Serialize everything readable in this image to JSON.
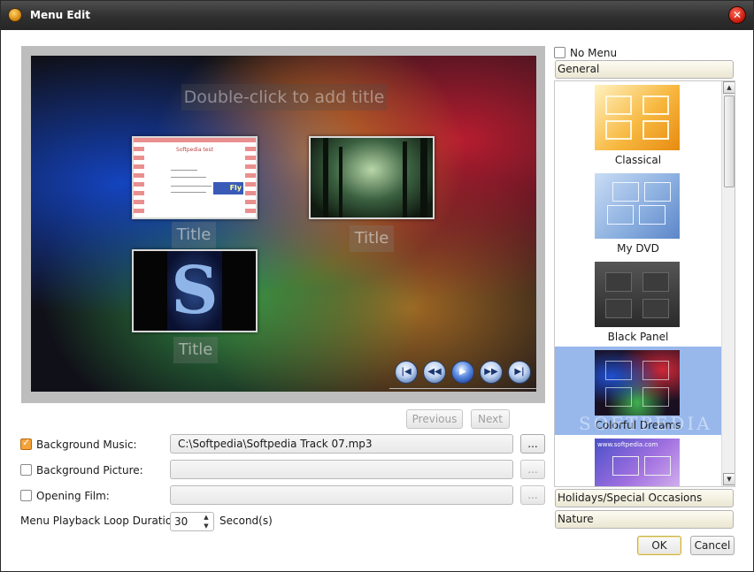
{
  "window": {
    "title": "Menu Edit"
  },
  "preview": {
    "title_placeholder": "Double-click to add title",
    "thumbnails": [
      {
        "label": "Title",
        "header": "Softpedia test",
        "logo": "Fly"
      },
      {
        "label": "Title"
      },
      {
        "label": "Title",
        "glyph": "S"
      }
    ]
  },
  "pager": {
    "previous": "Previous",
    "next": "Next"
  },
  "settings": {
    "background_music": {
      "label": "Background Music:",
      "checked": true,
      "value": "C:\\Softpedia\\Softpedia Track 07.mp3",
      "browse": "..."
    },
    "background_picture": {
      "label": "Background Picture:",
      "checked": false,
      "value": "",
      "browse": "..."
    },
    "opening_film": {
      "label": "Opening Film:",
      "checked": false,
      "value": "",
      "browse": "..."
    },
    "loop_duration": {
      "label": "Menu Playback Loop Duration:",
      "value": "30",
      "unit": "Second(s)"
    }
  },
  "templates": {
    "no_menu_label": "No Menu",
    "categories": [
      "General",
      "Holidays/Special Occasions",
      "Nature"
    ],
    "items": [
      {
        "name": "Classical"
      },
      {
        "name": "My DVD"
      },
      {
        "name": "Black Panel"
      },
      {
        "name": "Colorful Dreams",
        "selected": true
      },
      {
        "name": ""
      }
    ],
    "watermark": "SOFTPEDIA",
    "thumb_url": "www.softpedia.com"
  },
  "footer": {
    "ok": "OK",
    "cancel": "Cancel"
  }
}
